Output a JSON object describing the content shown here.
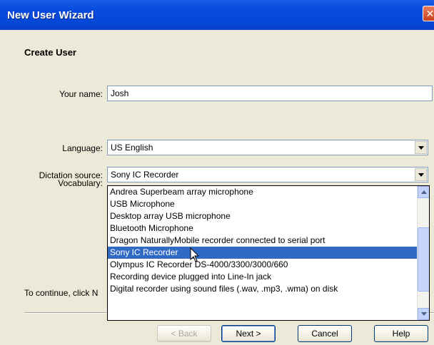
{
  "window": {
    "title": "New User Wizard",
    "close_label": "✕"
  },
  "page": {
    "heading": "Create User"
  },
  "form": {
    "name_label": "Your name:",
    "name_value": "Josh",
    "language_label": "Language:",
    "language_value": "US English",
    "dictation_label": "Dictation source:",
    "dictation_value": "Sony IC Recorder",
    "vocabulary_label": "Vocabulary:"
  },
  "dropdown": {
    "items": [
      "Andrea Superbeam array microphone",
      "USB Microphone",
      "Desktop array USB microphone",
      "Bluetooth Microphone",
      "Dragon NaturallyMobile recorder connected to serial port",
      "Sony IC Recorder",
      "Olympus IC Recorder DS-4000/3300/3000/660",
      "Recording device plugged into Line-In jack",
      "Digital recorder using sound files (.wav, .mp3, .wma) on disk"
    ],
    "selected_index": 5
  },
  "footer": {
    "continue_text": "To continue, click N",
    "back_label": "< Back",
    "next_label": "Next >",
    "cancel_label": "Cancel",
    "help_label": "Help"
  },
  "colors": {
    "titlebar": "#0548d8",
    "selection": "#316ac5",
    "dialog_bg": "#ece9d8"
  }
}
